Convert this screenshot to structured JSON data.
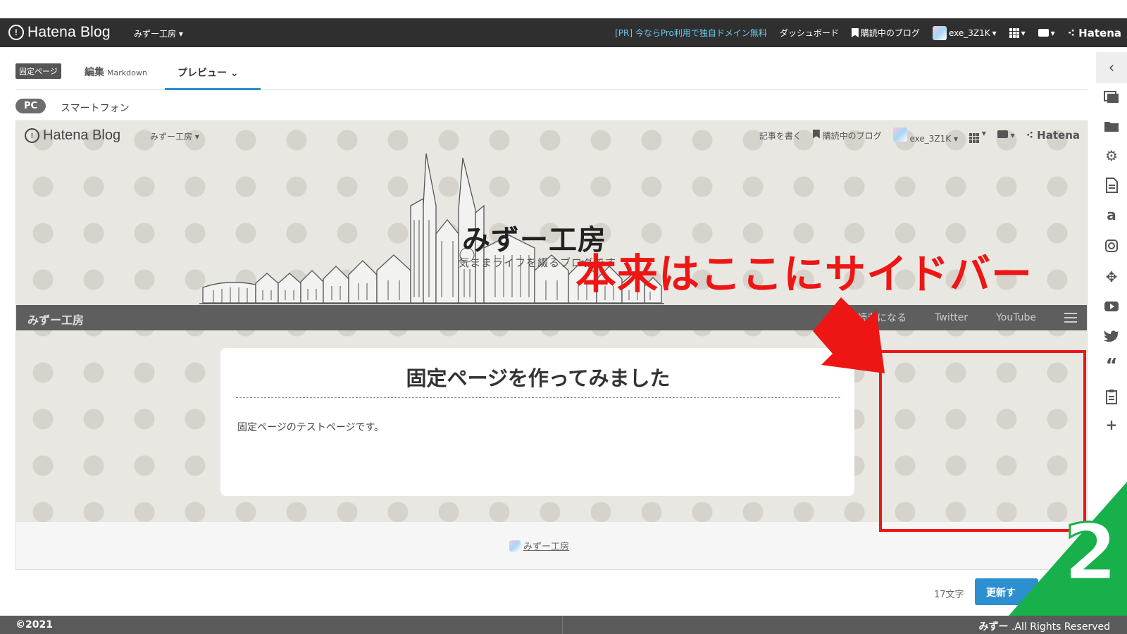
{
  "global_bar": {
    "logo_text": "Hatena Blog",
    "blog_selector": "みずー工房",
    "pr_text": "[PR] 今ならPro利用で独自ドメイン無料",
    "dashboard": "ダッシュボード",
    "subscribed": "購読中のブログ",
    "user": "exe_3Z1K",
    "brand": "Hatena"
  },
  "editor_tabs": {
    "badge": "固定ページ",
    "edit_label": "編集",
    "edit_mode": "Markdown",
    "preview_label": "プレビュー"
  },
  "device_switch": {
    "pc": "PC",
    "smartphone": "スマートフォン"
  },
  "preview": {
    "top": {
      "logo_text": "Hatena Blog",
      "blog_selector": "みずー工房",
      "write": "記事を書く",
      "subscribed": "購読中のブログ",
      "user": "exe_3Z1K",
      "brand": "Hatena"
    },
    "blog_title": "みずー工房",
    "blog_description": "気ままライフを綴るブログです",
    "global_nav": {
      "name": "みずー工房",
      "links": [
        "読者になる",
        "Twitter",
        "YouTube"
      ]
    },
    "article": {
      "title": "固定ページを作ってみました",
      "body": "固定ページのテストページです。"
    },
    "footer_link": "みずー工房"
  },
  "annotation": {
    "text": "本来はここにサイドバー",
    "color": "#ee1515"
  },
  "bottom_actions": {
    "char_count": "17文字",
    "update_button": "更新す"
  },
  "corner": {
    "number": "2",
    "color": "#18b04a"
  },
  "copyright": {
    "left": "©2021",
    "right_bold": "みずー",
    "right_rest": " .All Rights Reserved"
  },
  "icons": [
    "hatena-icon",
    "bookmark-icon",
    "grid-icon",
    "comment-icon",
    "chevron-left-icon",
    "photo-icon",
    "folder-icon",
    "gear-icon",
    "document-icon",
    "amazon-icon",
    "instagram-icon",
    "pinwheel-icon",
    "youtube-icon",
    "twitter-icon",
    "quote-icon",
    "clipboard-icon",
    "plus-icon"
  ],
  "colors": {
    "accent": "#2b8fd0",
    "bar": "#2f2f2f"
  }
}
